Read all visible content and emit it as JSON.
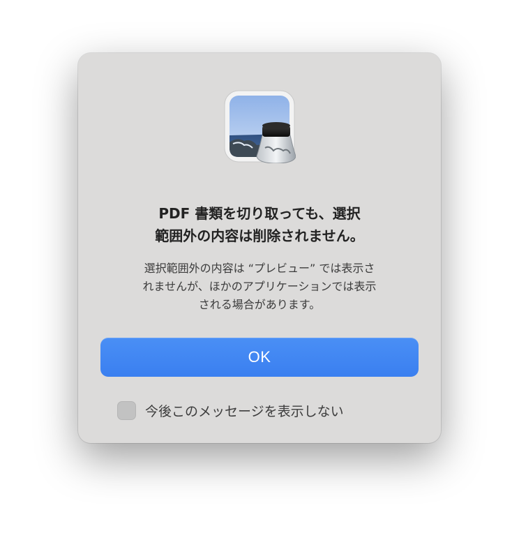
{
  "dialog": {
    "icon": "preview-app-icon",
    "headline_lines": [
      "PDF 書類を切り取っても、選択",
      "範囲外の内容は削除されません。"
    ],
    "message_lines": [
      "選択範囲外の内容は “プレビュー” では表示さ",
      "れませんが、ほかのアプリケーションでは表示",
      "される場合があります。"
    ],
    "ok_label": "OK",
    "suppress_label": "今後このメッセージを表示しない",
    "suppress_checked": false
  },
  "colors": {
    "dialog_background": "#dcdbda",
    "accent": "#3b82f0"
  }
}
